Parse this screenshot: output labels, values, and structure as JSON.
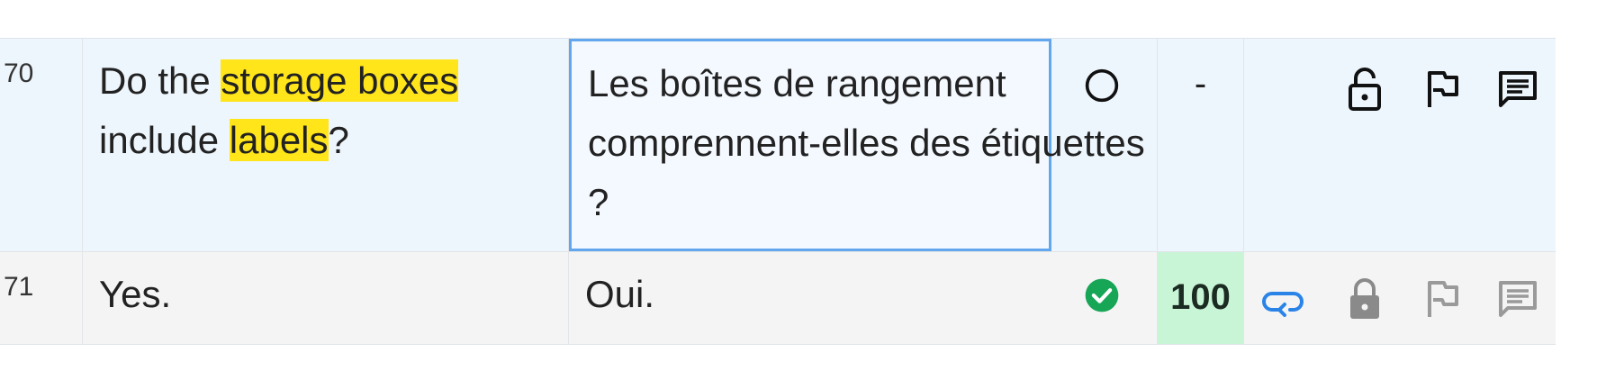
{
  "rows": [
    {
      "number": "70",
      "source": {
        "parts": [
          {
            "text": "Do the ",
            "hl": false
          },
          {
            "text": "storage boxes",
            "hl": true
          },
          {
            "text": " include ",
            "hl": false
          },
          {
            "text": "labels",
            "hl": true
          },
          {
            "text": "?",
            "hl": false
          }
        ]
      },
      "target": "Les boîtes de rangement comprennent-elles des étiquettes ?",
      "status": "empty-circle",
      "score": "-",
      "icons": [
        "lock-open-icon",
        "flag-icon",
        "comment-icon"
      ]
    },
    {
      "number": "71",
      "source": {
        "parts": [
          {
            "text": "Yes.",
            "hl": false
          }
        ]
      },
      "target": "Oui.",
      "status": "confirmed-check",
      "score": "100",
      "icons": [
        "repeat-icon",
        "lock-closed-icon",
        "flag-icon",
        "comment-icon"
      ]
    }
  ],
  "colors": {
    "highlight": "#ffe51a",
    "confirmed": "#17a556",
    "editor_border": "#62a7ee",
    "repeat": "#2a84e8",
    "match_bg": "#c9f5d7"
  }
}
